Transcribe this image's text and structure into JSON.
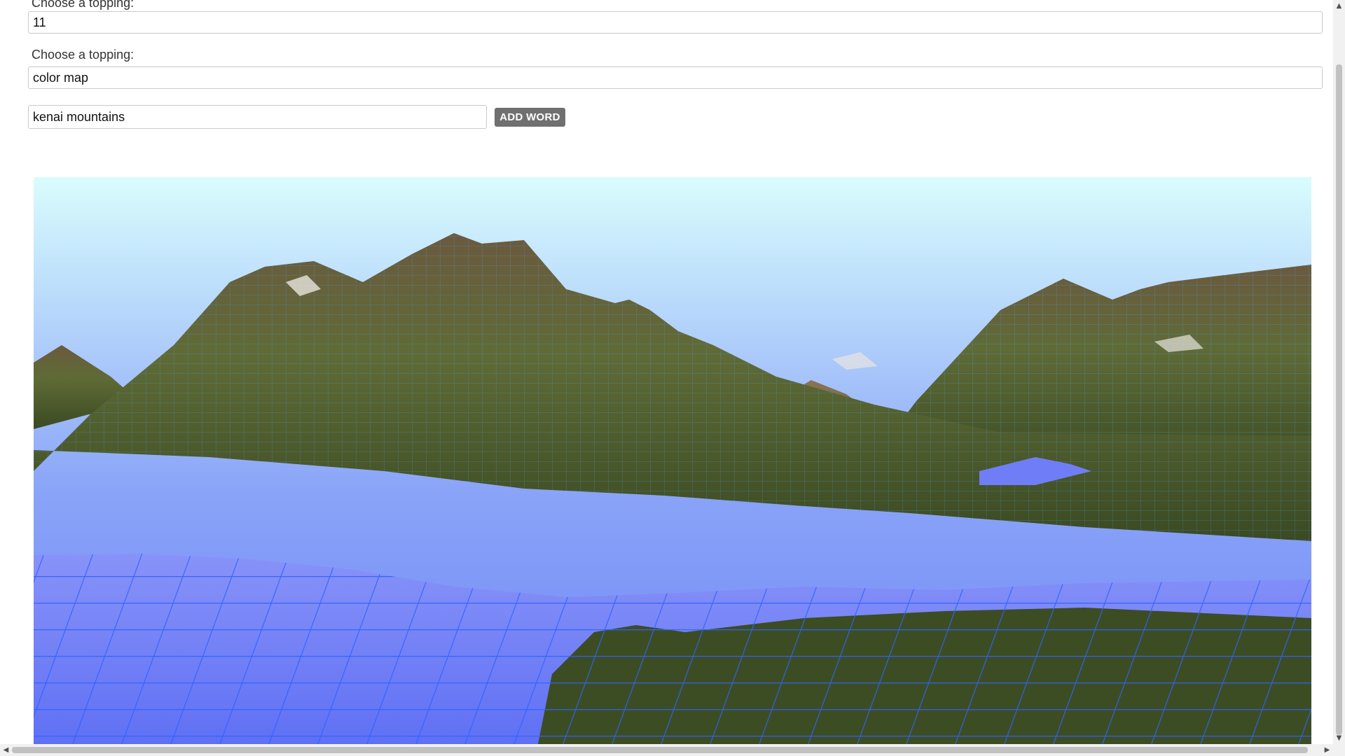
{
  "form": {
    "topping_label_1": "Choose a topping:",
    "topping_value_1": "11",
    "topping_label_2": "Choose a topping:",
    "topping_value_2": "color map",
    "word_value": "kenai mountains",
    "add_word_label": "ADD WORD"
  },
  "scene": {
    "sky_top_color": "#d8fdfd",
    "sky_bottom_color": "#7a95f8",
    "mountain_color": "#5b6230",
    "water_color": "#6f7ef6",
    "grid_color": "#3b8dff"
  },
  "icons": {
    "scroll_left": "arrow-left-icon",
    "scroll_right": "arrow-right-icon",
    "scroll_up": "arrow-up-icon",
    "scroll_down": "arrow-down-icon"
  }
}
